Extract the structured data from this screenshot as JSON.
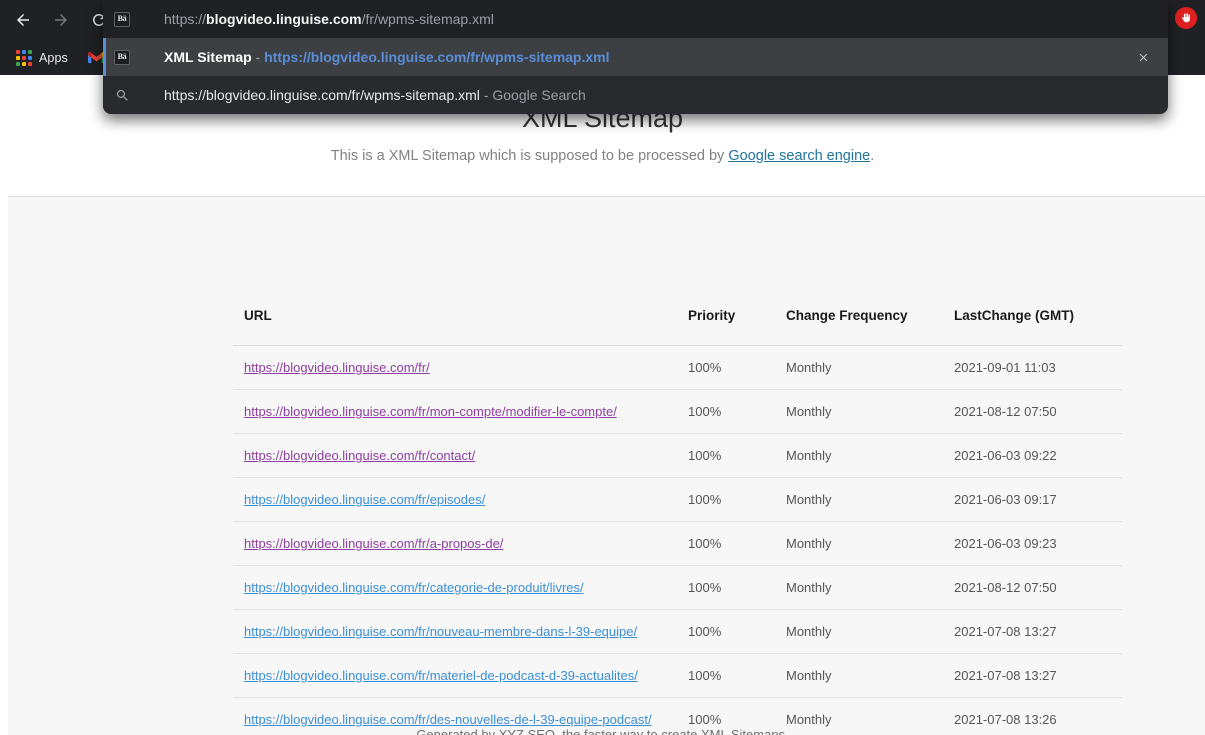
{
  "browser": {
    "back_label": "Back",
    "forward_label": "Forward",
    "reload_label": "Reload",
    "apps_label": "Apps",
    "gmail_label": "Gmail",
    "extension_label": "AdBlock",
    "omnibox": {
      "favicon_glyph": "Bä",
      "url_scheme": "https://",
      "url_host": "blogvideo.linguise.com",
      "url_path": "/fr/wpms-sitemap.xml",
      "close_label": "×"
    },
    "suggestions": [
      {
        "icon": "favicon",
        "favicon_glyph": "Bä",
        "title": "XML Sitemap",
        "separator": "-",
        "url": "https://blogvideo.linguise.com/fr/wpms-sitemap.xml",
        "selected": true
      },
      {
        "icon": "search-icon",
        "query": "https://blogvideo.linguise.com/fr/wpms-sitemap.xml",
        "separator": "-",
        "description": "Google Search",
        "selected": false
      }
    ]
  },
  "page": {
    "title": "XML Sitemap",
    "subtitle_before": "This is a XML Sitemap which is supposed to be processed by ",
    "subtitle_link": "Google search engine",
    "subtitle_after": ".",
    "footer": "Generated by XYZ SEO, the faster way to create XML Sitemaps.",
    "table": {
      "headers": [
        "URL",
        "Priority",
        "Change Frequency",
        "LastChange (GMT)"
      ],
      "rows": [
        {
          "url": "https://blogvideo.linguise.com/fr/",
          "visited": true,
          "priority": "100%",
          "frequency": "Monthly",
          "lastchange": "2021-09-01 11:03"
        },
        {
          "url": "https://blogvideo.linguise.com/fr/mon-compte/modifier-le-compte/",
          "visited": true,
          "priority": "100%",
          "frequency": "Monthly",
          "lastchange": "2021-08-12 07:50"
        },
        {
          "url": "https://blogvideo.linguise.com/fr/contact/",
          "visited": true,
          "priority": "100%",
          "frequency": "Monthly",
          "lastchange": "2021-06-03 09:22"
        },
        {
          "url": "https://blogvideo.linguise.com/fr/episodes/",
          "visited": false,
          "priority": "100%",
          "frequency": "Monthly",
          "lastchange": "2021-06-03 09:17"
        },
        {
          "url": "https://blogvideo.linguise.com/fr/a-propos-de/",
          "visited": true,
          "priority": "100%",
          "frequency": "Monthly",
          "lastchange": "2021-06-03 09:23"
        },
        {
          "url": "https://blogvideo.linguise.com/fr/categorie-de-produit/livres/",
          "visited": false,
          "priority": "100%",
          "frequency": "Monthly",
          "lastchange": "2021-08-12 07:50"
        },
        {
          "url": "https://blogvideo.linguise.com/fr/nouveau-membre-dans-l-39-equipe/",
          "visited": false,
          "priority": "100%",
          "frequency": "Monthly",
          "lastchange": "2021-07-08 13:27"
        },
        {
          "url": "https://blogvideo.linguise.com/fr/materiel-de-podcast-d-39-actualites/",
          "visited": false,
          "priority": "100%",
          "frequency": "Monthly",
          "lastchange": "2021-07-08 13:27"
        },
        {
          "url": "https://blogvideo.linguise.com/fr/des-nouvelles-de-l-39-equipe-podcast/",
          "visited": false,
          "priority": "100%",
          "frequency": "Monthly",
          "lastchange": "2021-07-08 13:26"
        }
      ]
    }
  },
  "colors": {
    "chrome_bg": "#202124",
    "popup_bg": "#292a2d",
    "selected_row": "#3c4043",
    "accent_blue": "#5b8dd9",
    "link_visited": "#8d3fa0",
    "link_unvisited": "#3c8fd6",
    "panel_bg": "#f7f7f7",
    "extension_red": "#e02020"
  }
}
